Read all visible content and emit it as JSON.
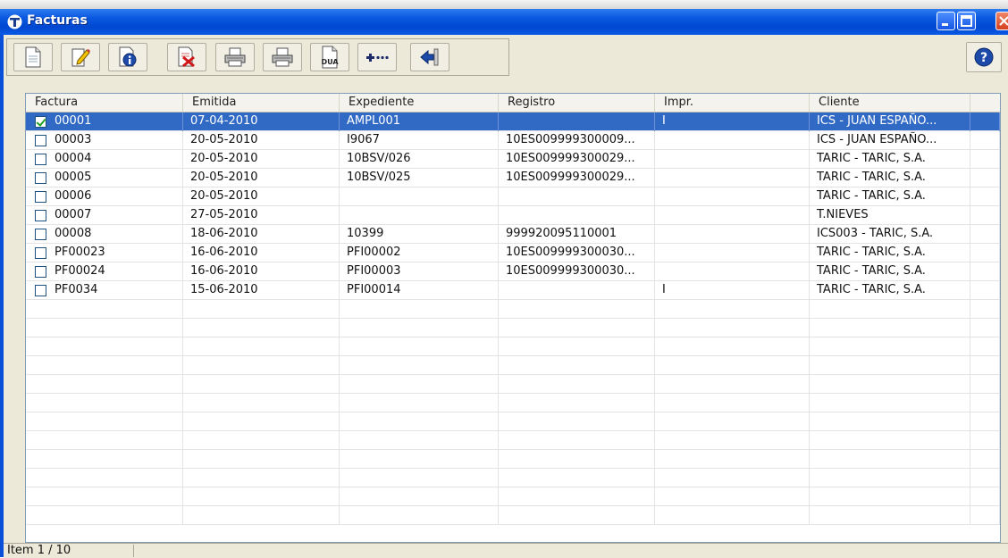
{
  "window": {
    "title": "Facturas"
  },
  "toolbar": {
    "buttons": [
      {
        "name": "new-document-button",
        "icon": "blank-document-icon"
      },
      {
        "name": "edit-document-button",
        "icon": "edit-pencil-icon"
      },
      {
        "name": "info-document-button",
        "icon": "info-icon"
      },
      {
        "name": "delete-document-button",
        "icon": "delete-document-icon"
      },
      {
        "name": "print-button",
        "icon": "printer-icon"
      },
      {
        "name": "print-preview-button",
        "icon": "printer-icon"
      },
      {
        "name": "dua-button",
        "icon": "dua-document-icon",
        "label": "DUA"
      },
      {
        "name": "more-button",
        "icon": "more-icon"
      },
      {
        "name": "back-button",
        "icon": "back-arrow-icon"
      }
    ],
    "help_icon": "help-icon"
  },
  "columns": [
    "Factura",
    "Emitida",
    "Expediente",
    "Registro",
    "Impr.",
    "Cliente"
  ],
  "rows": [
    {
      "factura": "00001",
      "emitida": "07-04-2010",
      "expediente": "AMPL001",
      "registro": "",
      "impr": "I",
      "cliente": "ICS - JUAN ESPAÑO...",
      "checked": true,
      "selected": true
    },
    {
      "factura": "00003",
      "emitida": "20-05-2010",
      "expediente": "I9067",
      "registro": "10ES009999300009...",
      "impr": "",
      "cliente": "ICS - JUAN ESPAÑO...",
      "checked": false,
      "selected": false
    },
    {
      "factura": "00004",
      "emitida": "20-05-2010",
      "expediente": "10BSV/026",
      "registro": "10ES009999300029...",
      "impr": "",
      "cliente": "TARIC - TARIC, S.A.",
      "checked": false,
      "selected": false
    },
    {
      "factura": "00005",
      "emitida": "20-05-2010",
      "expediente": "10BSV/025",
      "registro": "10ES009999300029...",
      "impr": "",
      "cliente": "TARIC - TARIC, S.A.",
      "checked": false,
      "selected": false
    },
    {
      "factura": "00006",
      "emitida": "20-05-2010",
      "expediente": "",
      "registro": "",
      "impr": "",
      "cliente": "TARIC - TARIC, S.A.",
      "checked": false,
      "selected": false
    },
    {
      "factura": "00007",
      "emitida": "27-05-2010",
      "expediente": "",
      "registro": "",
      "impr": "",
      "cliente": "T.NIEVES",
      "checked": false,
      "selected": false
    },
    {
      "factura": "00008",
      "emitida": "18-06-2010",
      "expediente": "10399",
      "registro": "999920095110001",
      "impr": "",
      "cliente": "ICS003 - TARIC, S.A.",
      "checked": false,
      "selected": false
    },
    {
      "factura": "PF00023",
      "emitida": "16-06-2010",
      "expediente": "PFI00002",
      "registro": "10ES009999300030...",
      "impr": "",
      "cliente": "TARIC - TARIC, S.A.",
      "checked": false,
      "selected": false
    },
    {
      "factura": "PF00024",
      "emitida": "16-06-2010",
      "expediente": "PFI00003",
      "registro": "10ES009999300030...",
      "impr": "",
      "cliente": "TARIC - TARIC, S.A.",
      "checked": false,
      "selected": false
    },
    {
      "factura": "PF0034",
      "emitida": "15-06-2010",
      "expediente": "PFI00014",
      "registro": "",
      "impr": "I",
      "cliente": "TARIC - TARIC, S.A.",
      "checked": false,
      "selected": false
    }
  ],
  "status": {
    "text": "Item 1 / 10"
  },
  "colors": {
    "titlebar": "#0a58e0",
    "selection": "#316ac5",
    "face": "#ece9d8"
  }
}
